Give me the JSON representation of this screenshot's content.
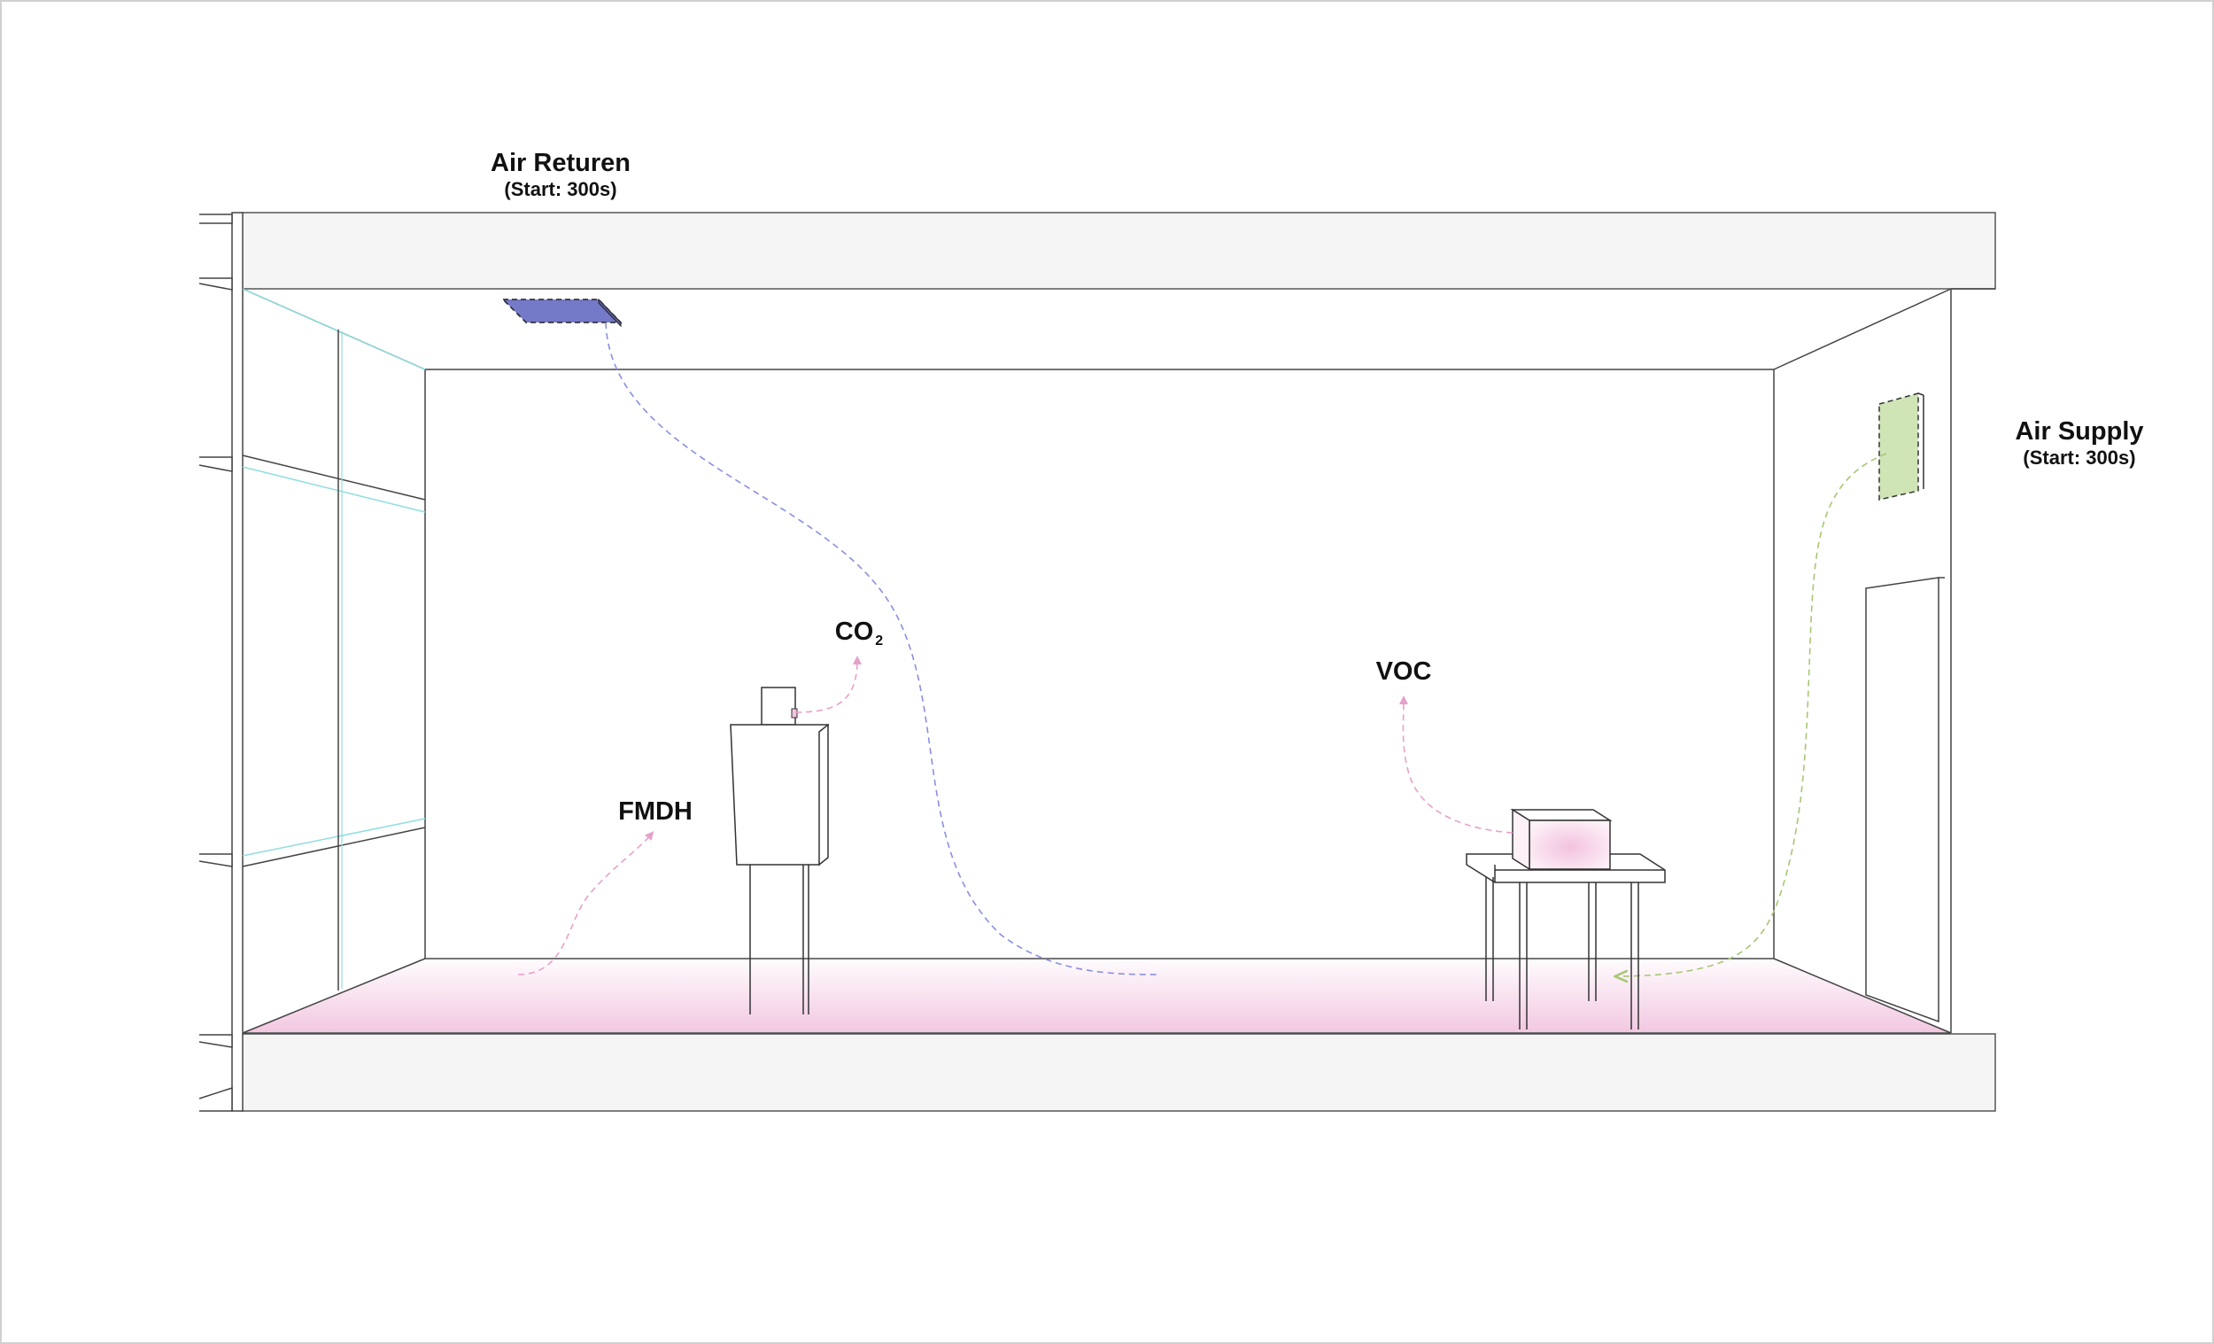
{
  "labels": {
    "air_return": {
      "title": "Air Returen",
      "subtitle": "(Start: 300s)"
    },
    "air_supply": {
      "title": "Air Supply",
      "subtitle": "(Start: 300s)"
    },
    "co2": {
      "text": "CO",
      "subscript": "2"
    },
    "voc": {
      "text": "VOC"
    },
    "fmdh": {
      "text": "FMDH"
    }
  },
  "colors": {
    "return_vent": "#7479c8",
    "return_flow": "#8a8fe0",
    "supply_vent": "#cfe5b6",
    "supply_flow": "#a6c774",
    "emission_arrow": "#e7a0cb",
    "floor_tint": "#f2c5e0",
    "glass": "#8fdede",
    "slab": "#f5f5f5"
  }
}
